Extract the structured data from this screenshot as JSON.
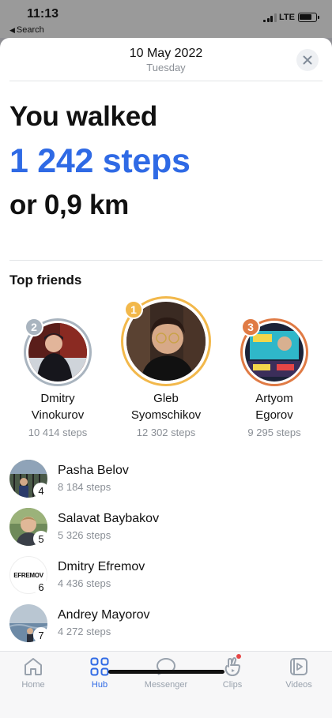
{
  "status_bar": {
    "time": "11:13",
    "back_label": "Search",
    "network": "LTE"
  },
  "header": {
    "date": "10 May 2022",
    "weekday": "Tuesday"
  },
  "summary": {
    "line1": "You walked",
    "steps": "1 242 steps",
    "distance": "or 0,9 km"
  },
  "top_friends": {
    "title": "Top friends",
    "podium": [
      {
        "rank": "2",
        "first_name": "Dmitry",
        "last_name": "Vinokurov",
        "steps": "10 414 steps",
        "color": "#a9b4bf"
      },
      {
        "rank": "1",
        "first_name": "Gleb",
        "last_name": "Syomschikov",
        "steps": "12 302 steps",
        "color": "#f2b84b"
      },
      {
        "rank": "3",
        "first_name": "Artyom",
        "last_name": "Egorov",
        "steps": "9 295 steps",
        "color": "#e07b45"
      }
    ],
    "list": [
      {
        "rank": "4",
        "name": "Pasha Belov",
        "steps": "8 184 steps"
      },
      {
        "rank": "5",
        "name": "Salavat Baybakov",
        "steps": "5 326 steps"
      },
      {
        "rank": "6",
        "name": "Dmitry Efremov",
        "steps": "4 436 steps",
        "avatar_text": "EFREMOV"
      },
      {
        "rank": "7",
        "name": "Andrey Mayorov",
        "steps": "4 272 steps"
      }
    ]
  },
  "tab_bar": {
    "tabs": [
      {
        "label": "Home",
        "icon": "home-icon"
      },
      {
        "label": "Hub",
        "icon": "hub-grid-icon",
        "active": true
      },
      {
        "label": "Messenger",
        "icon": "chat-bubble-icon"
      },
      {
        "label": "Clips",
        "icon": "clips-icon",
        "badge": true
      },
      {
        "label": "Videos",
        "icon": "video-play-icon"
      }
    ]
  },
  "colors": {
    "accent": "#2f6ae5",
    "secondary_text": "#8a8f96",
    "gold": "#f2b84b",
    "silver": "#a9b4bf",
    "bronze": "#e07b45"
  }
}
